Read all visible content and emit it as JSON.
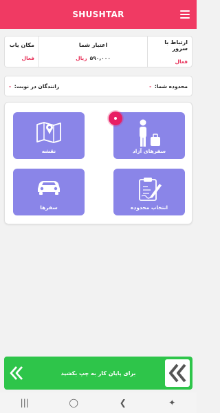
{
  "app": {
    "title": "SHUSHTAR"
  },
  "icons": {
    "menu": "hamburger-menu-icon"
  },
  "status": {
    "server": {
      "label": "ارتباط با سرور",
      "value": "فعال"
    },
    "credit": {
      "label": "اعتبار شما",
      "amount": "۵۹۰,۰۰۰",
      "unit": "ریال"
    },
    "locator": {
      "label": "مکان یاب",
      "value": "فعال"
    }
  },
  "zone": {
    "zone_label": "محدوده شما:",
    "zone_value": "-",
    "queue_label": "رانندگان در نوبت:",
    "queue_value": "-"
  },
  "tiles": {
    "free_trips": "سفرهای آزاد",
    "map": "نقشه",
    "select_zone": "انتخاب محدوده",
    "trips": "سفرها"
  },
  "swipe": {
    "label": "برای پایان کار به چپ بکشید"
  },
  "navbar": {
    "recent": "|||",
    "home": "◯",
    "back": "❮",
    "accessibility": "✦"
  },
  "colors": {
    "primary": "#f03a63",
    "tile": "#8a85e8",
    "swipe": "#2ec54a",
    "active": "#e8365d"
  }
}
